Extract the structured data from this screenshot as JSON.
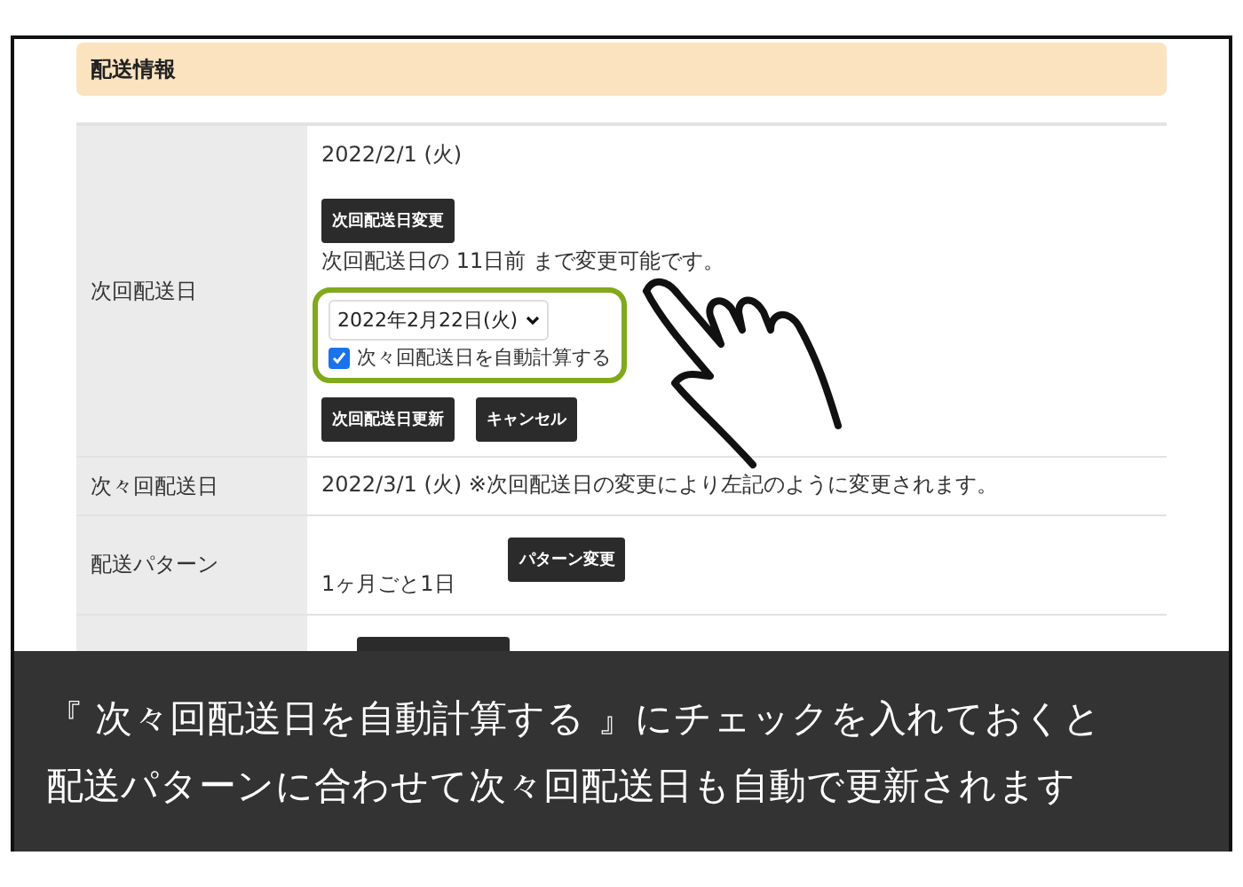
{
  "section_title": "配送情報",
  "next_delivery": {
    "label": "次回配送日",
    "date": "2022/2/1 (火)",
    "change_button": "次回配送日変更",
    "note": "次回配送日の 11日前 まで変更可能です。",
    "select_value": "2022年2月22日(火)",
    "auto_calc": {
      "label": "次々回配送日を自動計算する",
      "checked": true
    },
    "buttons": [
      "次回配送日更新",
      "キャンセル"
    ]
  },
  "following_delivery": {
    "label": "次々回配送日",
    "text": "2022/3/1 (火) ※次回配送日の変更により左記のように変更されます。"
  },
  "pattern": {
    "label": "配送パターン",
    "value": "1ヶ月ごと1日",
    "button": "パターン変更"
  },
  "caption": [
    "『 次々回配送日を自動計算する 』にチェックを入れておくと",
    "配送パターンに合わせて次々回配送日も自動で更新されます"
  ]
}
